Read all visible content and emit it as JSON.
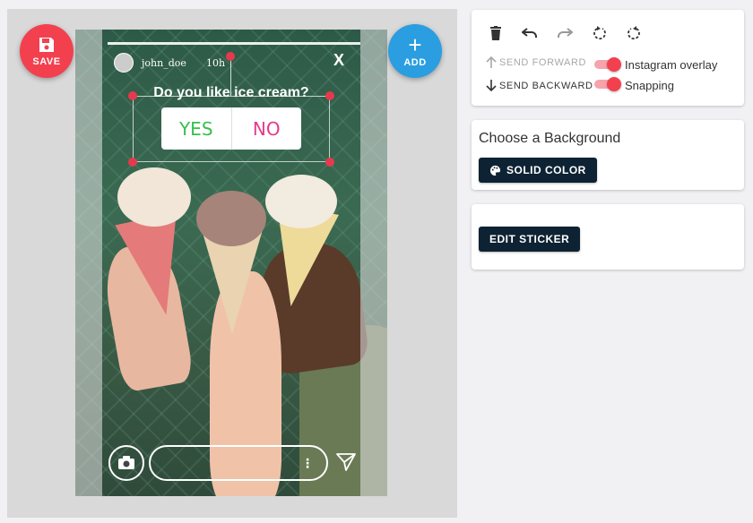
{
  "fabs": {
    "save_label": "SAVE",
    "add_label": "ADD"
  },
  "story": {
    "username": "john_doe",
    "timestamp": "10h",
    "close": "X",
    "sticker": {
      "question": "Do you like ice cream?",
      "yes_label": "YES",
      "no_label": "NO"
    }
  },
  "toolbar": {
    "icons": [
      "trash-icon",
      "undo-icon",
      "redo-icon",
      "rotate-left-icon",
      "rotate-right-icon"
    ],
    "send_forward_label": "SEND FORWARD",
    "send_backward_label": "SEND BACKWARD",
    "instagram_overlay_label": "Instagram overlay",
    "snapping_label": "Snapping",
    "instagram_overlay_on": true,
    "snapping_on": true
  },
  "background_panel": {
    "title": "Choose a Background",
    "solid_color_label": "SOLID COLOR"
  },
  "sticker_panel": {
    "edit_sticker_label": "EDIT STICKER"
  },
  "colors": {
    "accent_red": "#f3404f",
    "accent_blue": "#2a9ee0",
    "dark_button": "#0d2233",
    "yes_green": "#36c04b",
    "no_pink": "#e53a8a"
  }
}
